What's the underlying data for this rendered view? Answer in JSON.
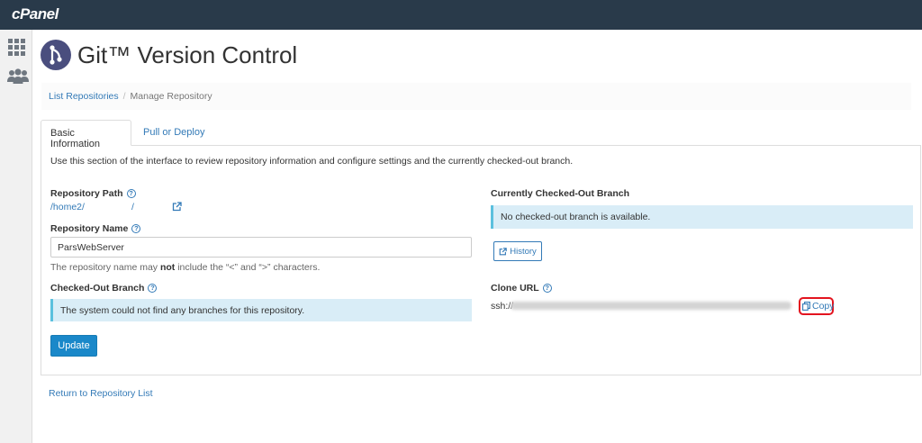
{
  "topbar": {
    "brand": "cPanel"
  },
  "header": {
    "title": "Git™ Version Control"
  },
  "breadcrumb": {
    "link": "List Repositories",
    "separator": "/",
    "current": "Manage Repository"
  },
  "tabs": [
    {
      "label": "Basic Information"
    },
    {
      "label": "Pull or Deploy"
    }
  ],
  "intro": "Use this section of the interface to review repository information and configure settings and the currently checked-out branch.",
  "repo_path": {
    "label": "Repository Path",
    "value": "/home2/",
    "slash": "/"
  },
  "repo_name": {
    "label": "Repository Name",
    "value": "ParsWebServer"
  },
  "name_help": {
    "pre": "The repository name may ",
    "bold": "not",
    "post": " include the “<” and “>” characters."
  },
  "checked_out_branch": {
    "label": "Checked-Out Branch",
    "alert": "The system could not find any branches for this repository."
  },
  "update_label": "Update",
  "current_branch": {
    "label": "Currently Checked-Out Branch",
    "alert": "No checked-out branch is available."
  },
  "history_label": "History",
  "clone": {
    "label": "Clone URL",
    "prefix": "ssh://",
    "copy_label": "Copy"
  },
  "return_label": "Return to Repository List",
  "help_glyph": "?",
  "colors": {
    "topbar": "#293a4a",
    "accent": "#337ab7",
    "alert_bg": "#d9edf7",
    "primary_btn": "#1a88c9",
    "highlight": "#e3141f"
  }
}
